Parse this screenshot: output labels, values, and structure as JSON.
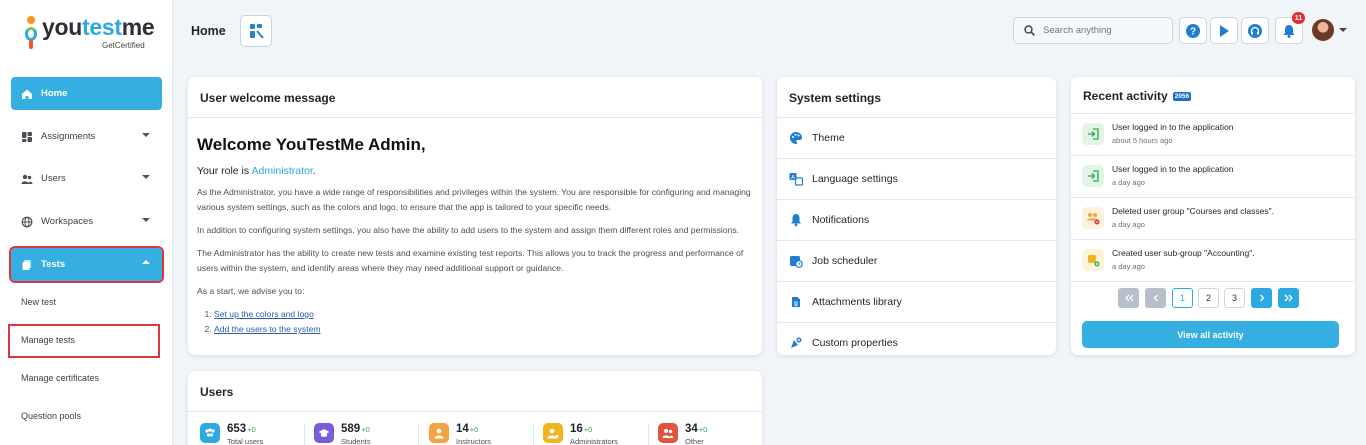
{
  "logo": {
    "brand_pre": "you",
    "brand_accent": "test",
    "brand_post": "me",
    "tagline": "GetCertified"
  },
  "sidebar": {
    "items": [
      {
        "label": "Home"
      },
      {
        "label": "Assignments"
      },
      {
        "label": "Users"
      },
      {
        "label": "Workspaces"
      },
      {
        "label": "Tests"
      }
    ],
    "sub_items": [
      {
        "label": "New test"
      },
      {
        "label": "Manage tests"
      },
      {
        "label": "Manage certificates"
      },
      {
        "label": "Question pools"
      }
    ]
  },
  "header": {
    "title": "Home",
    "search_placeholder": "Search anything",
    "notification_count": "11"
  },
  "welcome": {
    "title": "User welcome message",
    "heading": "Welcome YouTestMe Admin,",
    "role_prefix": "Your role is ",
    "role": "Administrator",
    "role_suffix": ".",
    "p1": "As the Administrator, you have a wide range of responsibilities and privileges within the system. You are responsible for configuring and managing various system settings, such as the colors and logo, to ensure that the app is tailored to your specific needs.",
    "p2": "In addition to configuring system settings, you also have the ability to add users to the system and assign them different roles and permissions.",
    "p3": "The Administrator has the ability to create new tests and examine existing test reports. This allows you to track the progress and performance of users within the system, and identify areas where they may need additional support or guidance.",
    "p4": "As a start, we advise you to:",
    "links": [
      "Set up the colors and logo",
      "Add the users to the system"
    ]
  },
  "system_settings": {
    "title": "System settings",
    "items": [
      {
        "label": "Theme"
      },
      {
        "label": "Language settings"
      },
      {
        "label": "Notifications"
      },
      {
        "label": "Job scheduler"
      },
      {
        "label": "Attachments library"
      },
      {
        "label": "Custom properties"
      }
    ]
  },
  "recent_activity": {
    "title": "Recent activity",
    "count": "2056",
    "items": [
      {
        "title": "User logged in to the application",
        "time": "about 5 hours ago",
        "icon": "login-icon"
      },
      {
        "title": "User logged in to the application",
        "time": "a day ago",
        "icon": "login-icon"
      },
      {
        "title": "Deleted user group \"Courses and classes\".",
        "time": "a day ago",
        "icon": "group-delete-icon"
      },
      {
        "title": "Created user sub-group \"Accounting\".",
        "time": "a day ago",
        "icon": "group-add-icon"
      }
    ],
    "pages": [
      "1",
      "2",
      "3"
    ],
    "current_page": "1",
    "view_all_label": "View all activity"
  },
  "users": {
    "title": "Users",
    "stats": [
      {
        "value": "653",
        "delta": "+0",
        "label": "Total users",
        "color": "#2ba9e0"
      },
      {
        "value": "589",
        "delta": "+0",
        "label": "Students",
        "color": "#7b5cd6"
      },
      {
        "value": "14",
        "delta": "+0",
        "label": "Instructors",
        "color": "#f5a340"
      },
      {
        "value": "16",
        "delta": "+0",
        "label": "Administrators",
        "color": "#f2b320"
      },
      {
        "value": "34",
        "delta": "+0",
        "label": "Other",
        "color": "#e2553c"
      }
    ]
  },
  "colors": {
    "accent": "#35aee2",
    "highlight_outline": "#d9373b",
    "notification": "#e03131"
  }
}
